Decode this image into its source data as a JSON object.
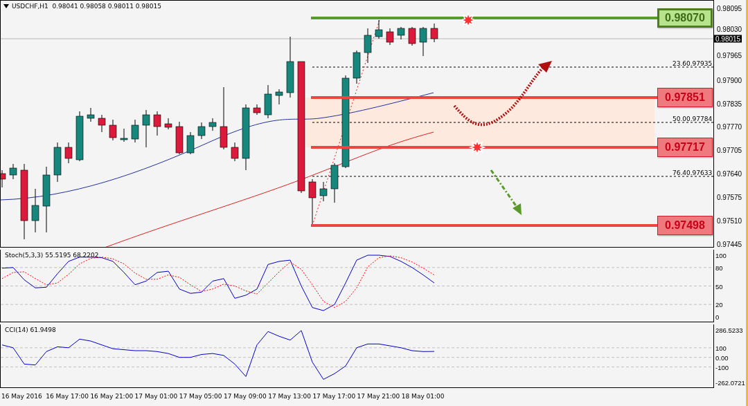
{
  "main_chart": {
    "header": "USDCHF,H1  0.98041 0.98058 0.98011 0.98015",
    "price_axis": [
      "0.98095",
      "0.98030",
      "0.97965",
      "0.97900",
      "0.97835",
      "0.97770",
      "0.97705",
      "0.97640",
      "0.97575",
      "0.97510",
      "0.97445"
    ],
    "current_price": "0.98015",
    "levels": [
      {
        "label": "0.98070",
        "kind": "resistance"
      },
      {
        "label": "0.97851",
        "kind": "support"
      },
      {
        "label": "0.97717",
        "kind": "support"
      },
      {
        "label": "0.97498",
        "kind": "support"
      }
    ],
    "fibonacci": [
      {
        "ratio": "23.6",
        "price": "0.97935"
      },
      {
        "ratio": "50.0",
        "price": "0.97784"
      },
      {
        "ratio": "76.4",
        "price": "0.97633"
      }
    ]
  },
  "stoch_panel": {
    "chart_data": {
      "type": "line",
      "title": "Stoch(5,3,3) 55.5195 68.2202",
      "grid": true,
      "ylim": [
        -9,
        109
      ],
      "yticks": [
        {
          "value": 0,
          "label": "0"
        },
        {
          "value": 20,
          "label": "20"
        },
        {
          "value": 50,
          "label": "50"
        },
        {
          "value": 80,
          "label": "80"
        },
        {
          "value": 100,
          "label": "100"
        }
      ],
      "series": [
        {
          "color": "#0000cc",
          "line_style": "solid",
          "values": [
            79,
            80,
            60,
            47,
            48,
            70,
            90,
            97,
            97,
            96,
            90,
            72,
            52,
            58,
            72,
            74,
            45,
            38,
            40,
            58,
            62,
            30,
            35,
            45,
            85,
            90,
            92,
            50,
            15,
            10,
            20,
            55,
            92,
            100,
            100,
            98,
            90,
            80,
            68,
            55
          ]
        },
        {
          "color": "#ff0000",
          "line_style": "dashed",
          "values": [
            62,
            72,
            73,
            62,
            52,
            55,
            69,
            86,
            95,
            97,
            94,
            86,
            71,
            61,
            61,
            68,
            64,
            52,
            41,
            45,
            53,
            50,
            42,
            37,
            55,
            73,
            89,
            77,
            52,
            25,
            15,
            25,
            47,
            81,
            96,
            99,
            96,
            89,
            79,
            68
          ]
        }
      ]
    }
  },
  "cci_panel": {
    "chart_data": {
      "type": "line",
      "title": "CCI(14) 61.9498",
      "grid": true,
      "ylim": [
        -320,
        344
      ],
      "yticks": [
        {
          "value": 286.5233,
          "label": "286.5233"
        },
        {
          "value": 100,
          "label": "100"
        },
        {
          "value": 0,
          "label": "0.00"
        },
        {
          "value": -100,
          "label": "-100"
        },
        {
          "value": -262.0721,
          "label": "-262.0721"
        }
      ],
      "series": [
        {
          "color": "#0000cc",
          "line_style": "solid",
          "values": [
            130,
            100,
            -70,
            -80,
            60,
            110,
            100,
            190,
            170,
            130,
            90,
            80,
            70,
            70,
            60,
            40,
            0,
            0,
            30,
            40,
            20,
            -70,
            -200,
            130,
            270,
            220,
            180,
            280,
            -50,
            -230,
            -170,
            -90,
            100,
            140,
            140,
            120,
            100,
            70,
            60,
            62
          ]
        }
      ]
    }
  },
  "time_axis": [
    "16 May 2016",
    "16 May 17:00",
    "16 May 21:00",
    "17 May 01:00",
    "17 May 05:00",
    "17 May 09:00",
    "17 May 13:00",
    "17 May 17:00",
    "17 May 21:00",
    "18 May 01:00"
  ]
}
